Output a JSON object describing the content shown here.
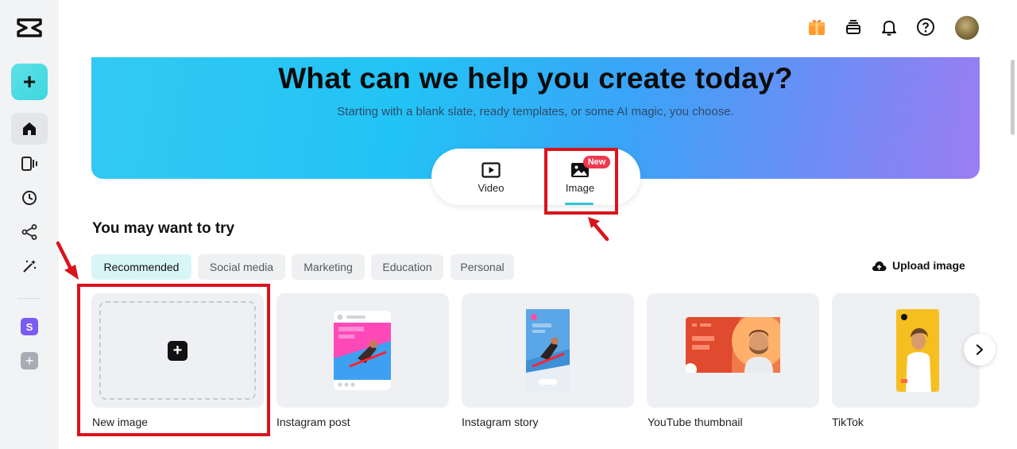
{
  "hero": {
    "title": "What can we help you create today?",
    "subtitle": "Starting with a blank slate, ready templates, or some AI magic, you choose."
  },
  "switcher": {
    "video_label": "Video",
    "image_label": "Image",
    "new_badge": "New",
    "selected": "Image"
  },
  "section": {
    "title": "You may want to try"
  },
  "chips": [
    "Recommended",
    "Social media",
    "Marketing",
    "Education",
    "Personal"
  ],
  "active_chip": "Recommended",
  "upload_label": "Upload image",
  "cards": [
    {
      "label": "New image"
    },
    {
      "label": "Instagram post"
    },
    {
      "label": "Instagram story"
    },
    {
      "label": "YouTube thumbnail"
    },
    {
      "label": "TikTok"
    }
  ],
  "sidebar": {
    "create_icon": "plus-icon",
    "items": [
      "home-icon",
      "video-projects-icon",
      "recent-icon",
      "share-icon",
      "magic-tools-icon"
    ],
    "workspace_initial": "S"
  },
  "topbar_icons": [
    "gift-icon",
    "storage-icon",
    "bell-icon",
    "help-icon",
    "avatar"
  ],
  "colors": {
    "accent": "#2fc6d9",
    "highlight": "#d9141e",
    "badge": "#f0384f"
  }
}
